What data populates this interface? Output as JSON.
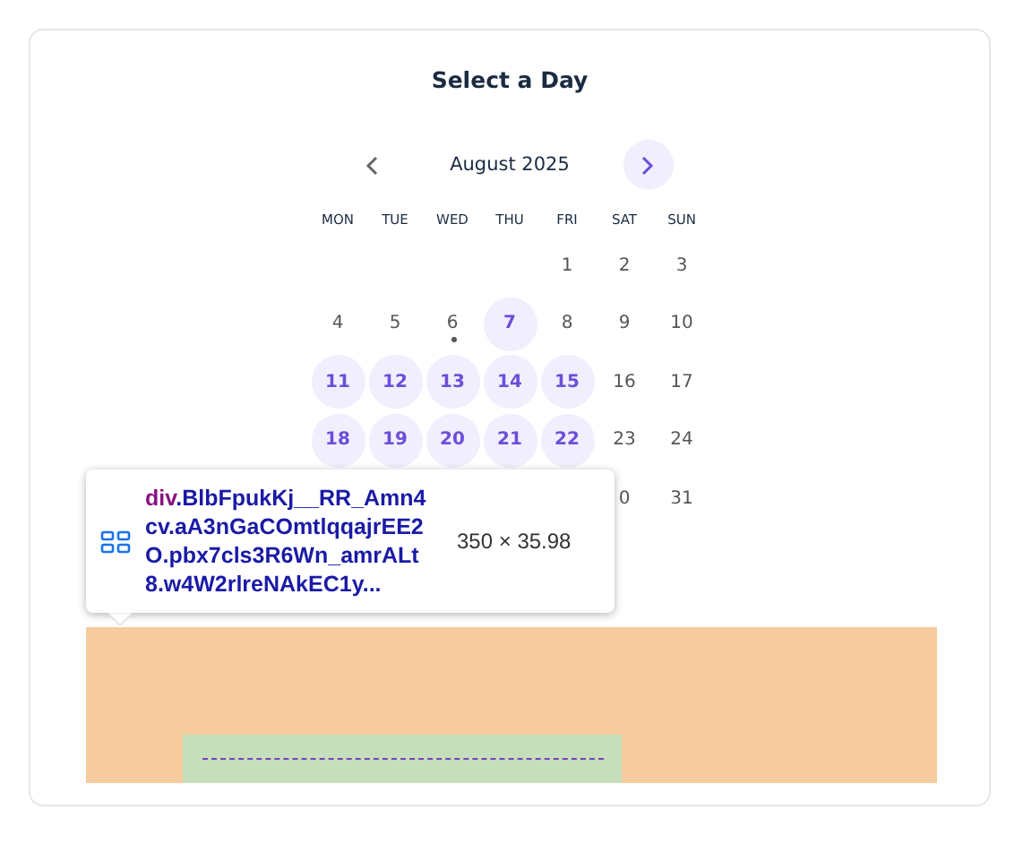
{
  "title": "Select a Day",
  "month": {
    "label": "August 2025",
    "prev": {
      "highlighted": false
    },
    "next": {
      "highlighted": true
    }
  },
  "weekdays": [
    "MON",
    "TUE",
    "WED",
    "THU",
    "FRI",
    "SAT",
    "SUN"
  ],
  "weeks": [
    [
      {
        "kind": "blank"
      },
      {
        "kind": "blank"
      },
      {
        "kind": "blank"
      },
      {
        "kind": "blank"
      },
      {
        "kind": "day",
        "label": "1",
        "available": false,
        "today": false
      },
      {
        "kind": "day",
        "label": "2",
        "available": false,
        "today": false
      },
      {
        "kind": "day",
        "label": "3",
        "available": false,
        "today": false
      }
    ],
    [
      {
        "kind": "day",
        "label": "4",
        "available": false,
        "today": false
      },
      {
        "kind": "day",
        "label": "5",
        "available": false,
        "today": false
      },
      {
        "kind": "day",
        "label": "6",
        "available": false,
        "today": true
      },
      {
        "kind": "day",
        "label": "7",
        "available": true,
        "today": false
      },
      {
        "kind": "day",
        "label": "8",
        "available": false,
        "today": false
      },
      {
        "kind": "day",
        "label": "9",
        "available": false,
        "today": false
      },
      {
        "kind": "day",
        "label": "10",
        "available": false,
        "today": false
      }
    ],
    [
      {
        "kind": "day",
        "label": "11",
        "available": true,
        "today": false
      },
      {
        "kind": "day",
        "label": "12",
        "available": true,
        "today": false
      },
      {
        "kind": "day",
        "label": "13",
        "available": true,
        "today": false
      },
      {
        "kind": "day",
        "label": "14",
        "available": true,
        "today": false
      },
      {
        "kind": "day",
        "label": "15",
        "available": true,
        "today": false
      },
      {
        "kind": "day",
        "label": "16",
        "available": false,
        "today": false
      },
      {
        "kind": "day",
        "label": "17",
        "available": false,
        "today": false
      }
    ],
    [
      {
        "kind": "day",
        "label": "18",
        "available": true,
        "today": false
      },
      {
        "kind": "day",
        "label": "19",
        "available": true,
        "today": false
      },
      {
        "kind": "day",
        "label": "20",
        "available": true,
        "today": false
      },
      {
        "kind": "day",
        "label": "21",
        "available": true,
        "today": false
      },
      {
        "kind": "day",
        "label": "22",
        "available": true,
        "today": false
      },
      {
        "kind": "day",
        "label": "23",
        "available": false,
        "today": false
      },
      {
        "kind": "day",
        "label": "24",
        "available": false,
        "today": false
      }
    ],
    [
      {
        "kind": "blank"
      },
      {
        "kind": "blank"
      },
      {
        "kind": "blank"
      },
      {
        "kind": "blank"
      },
      {
        "kind": "blank"
      },
      {
        "kind": "day",
        "label": "0",
        "available": false,
        "today": false
      },
      {
        "kind": "day",
        "label": "31",
        "available": false,
        "today": false
      }
    ]
  ],
  "inspector_tooltip": {
    "tag": "div",
    "selector": ".BlbFpukKj__RR_Amn4cv.aA3nGaCOmtlqqajrEE2O.pbx7cls3R6Wn_amrALt8.w4W2rlreNAkEC1y...",
    "size": "350 × 35.98"
  }
}
